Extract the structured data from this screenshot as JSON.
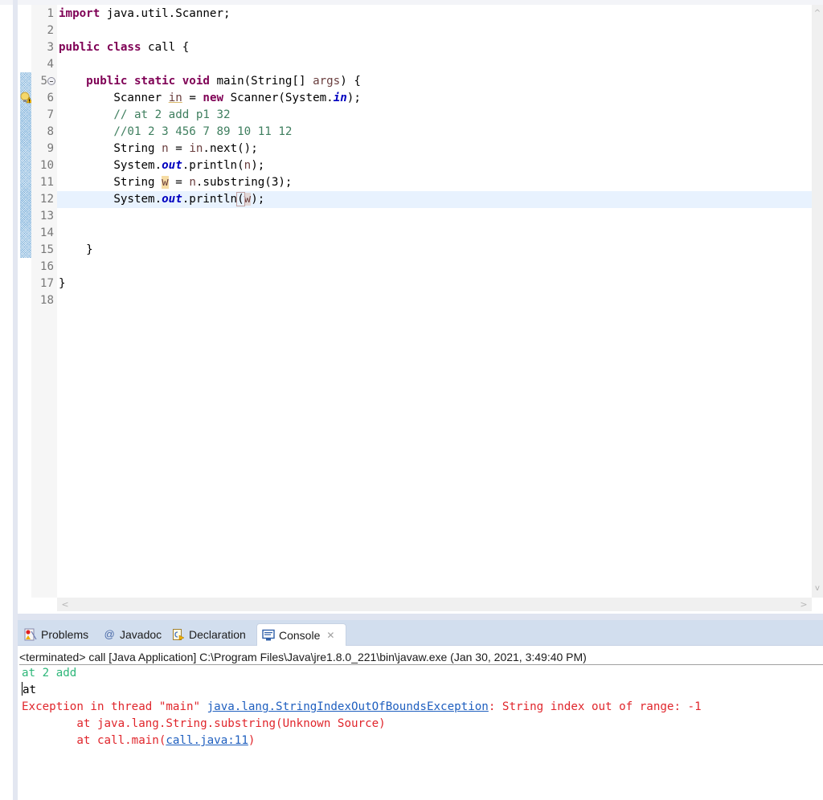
{
  "editor": {
    "lines": [
      {
        "no": "1"
      },
      {
        "no": "2"
      },
      {
        "no": "3"
      },
      {
        "no": "4"
      },
      {
        "no": "5"
      },
      {
        "no": "6"
      },
      {
        "no": "7"
      },
      {
        "no": "8"
      },
      {
        "no": "9"
      },
      {
        "no": "10"
      },
      {
        "no": "11"
      },
      {
        "no": "12"
      },
      {
        "no": "13"
      },
      {
        "no": "14"
      },
      {
        "no": "15"
      },
      {
        "no": "16"
      },
      {
        "no": "17"
      },
      {
        "no": "18"
      }
    ],
    "code": {
      "l1_kw": "import",
      "l1_rest": " java.util.Scanner;",
      "l3_kw1": "public",
      "l3_kw2": "class",
      "l3_rest": " call {",
      "l5_indent": "    ",
      "l5_kw1": "public",
      "l5_kw2": "static",
      "l5_kw3": "void",
      "l5_a": " main(String[] ",
      "l5_var": "args",
      "l5_b": ") {",
      "l6_indent": "        ",
      "l6_a": "Scanner ",
      "l6_var": "in",
      "l6_b": " = ",
      "l6_kw": "new",
      "l6_c": " Scanner(System.",
      "l6_fld": "in",
      "l6_d": ");",
      "l7_indent": "        ",
      "l7_cm": "// at 2 add p1 32",
      "l8_indent": "        ",
      "l8_cm": "//01 2 3 456 7 89 10 11 12",
      "l9_indent": "        ",
      "l9_a": "String ",
      "l9_var": "n",
      "l9_b": " = ",
      "l9_var2": "in",
      "l9_c": ".next();",
      "l10_indent": "        ",
      "l10_a": "System.",
      "l10_fld": "out",
      "l10_b": ".println(",
      "l10_var": "n",
      "l10_c": ");",
      "l11_indent": "        ",
      "l11_a": "String ",
      "l11_var": "w",
      "l11_b": " = ",
      "l11_var2": "n",
      "l11_c": ".substring(3);",
      "l12_indent": "        ",
      "l12_a": "System.",
      "l12_fld": "out",
      "l12_b": ".println",
      "l12_paren": "(",
      "l12_var": "w",
      "l12_c": ");",
      "l15_indent": "    ",
      "l15_a": "}",
      "l17_a": "}"
    },
    "markers": {
      "warning_line": "6",
      "fold_line": "5"
    },
    "scroll": {
      "up": "^",
      "down": "v",
      "left": "<",
      "right": ">"
    }
  },
  "panel": {
    "tabs": [
      {
        "label": "Problems",
        "icon": "problems-icon"
      },
      {
        "label": "Javadoc",
        "icon": "javadoc-icon",
        "glyph": "@"
      },
      {
        "label": "Declaration",
        "icon": "declaration-icon"
      },
      {
        "label": "Console",
        "icon": "console-icon",
        "active": true,
        "close": "✕"
      }
    ],
    "console": {
      "header": "<terminated> call [Java Application] C:\\Program Files\\Java\\jre1.8.0_221\\bin\\javaw.exe (Jan 30, 2021, 3:49:40 PM)",
      "input_line": "at 2 add",
      "output_line": "at",
      "error_prefix": "Exception in thread \"main\" ",
      "error_link": "java.lang.StringIndexOutOfBoundsException",
      "error_suffix": ": String index out of range: -1",
      "stack1": "        at java.lang.String.substring(Unknown Source)",
      "stack2_prefix": "        at call.main(",
      "stack2_link": "call.java:11",
      "stack2_suffix": ")"
    }
  },
  "colors": {
    "keyword": "#7f0055",
    "comment": "#3f7f5f",
    "field": "#0000c0",
    "console_input": "#2fb77a",
    "console_error": "#e0262c",
    "link": "#1f5fbf"
  }
}
